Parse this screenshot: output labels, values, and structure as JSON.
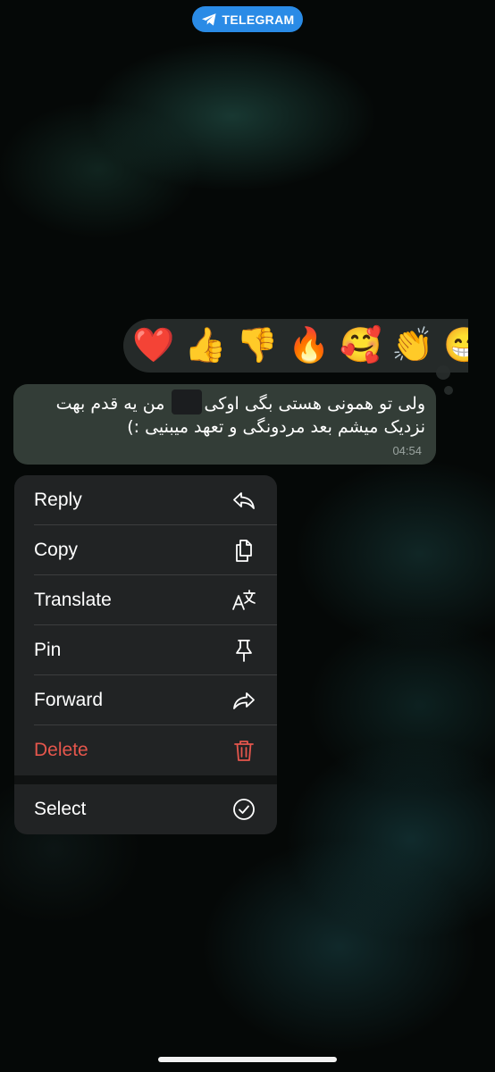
{
  "badge": {
    "label": "TELEGRAM"
  },
  "reactions": [
    "❤️",
    "👍",
    "👎",
    "🔥",
    "🥰",
    "👏",
    "😁"
  ],
  "message": {
    "line1": "ولی تو همونی هستی بگی اوکی",
    "line1_rest": "من یه قدم بهت",
    "line2": "نزدیک میشم بعد مردونگی و تعهد میبنیی :)",
    "time": "04:54"
  },
  "menu": {
    "items": [
      {
        "label": "Reply",
        "icon": "reply-icon"
      },
      {
        "label": "Copy",
        "icon": "copy-icon"
      },
      {
        "label": "Translate",
        "icon": "translate-icon"
      },
      {
        "label": "Pin",
        "icon": "pin-icon"
      },
      {
        "label": "Forward",
        "icon": "forward-icon"
      },
      {
        "label": "Delete",
        "icon": "trash-icon",
        "color": "#e5564c"
      }
    ],
    "select": {
      "label": "Select",
      "icon": "checkmark-circle-icon"
    }
  },
  "colors": {
    "badge": "#2a8be6",
    "danger": "#e5564c"
  }
}
